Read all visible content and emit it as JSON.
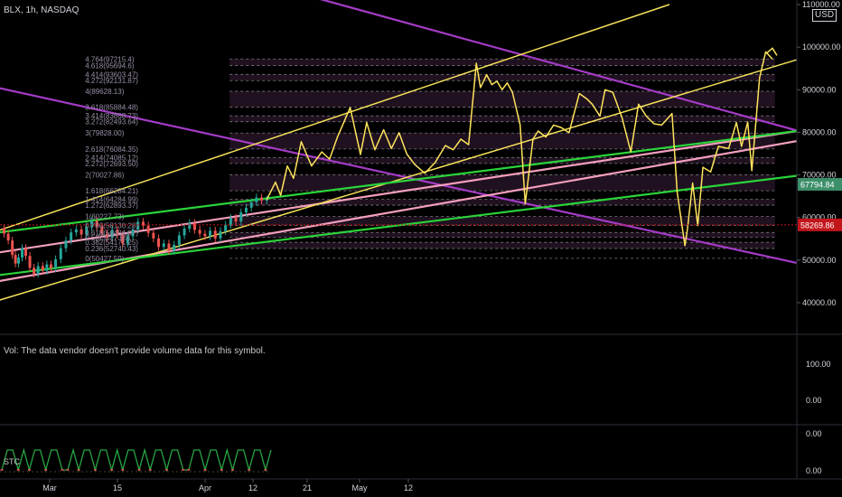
{
  "header": {
    "symbol_info": "BLX, 1h, NASDAQ"
  },
  "price_scale": {
    "currency": "USD",
    "ticks": [
      "110000.00",
      "100000.00",
      "90000.00",
      "80000.00",
      "70000.00",
      "60000.00",
      "50000.00",
      "40000.00"
    ],
    "badges": [
      {
        "text": "67794.84",
        "value": 67794.84,
        "color": "#3d8f6a"
      },
      {
        "text": "58269.86",
        "value": 58269.86,
        "color": "#c2161b"
      }
    ]
  },
  "volume_pane": {
    "message": "Vol: The data vendor doesn't provide volume data for this symbol.",
    "ticks": [
      "100.00",
      "0.00"
    ]
  },
  "stc_pane": {
    "label": "STC",
    "ticks": [
      "0.00",
      "0.00"
    ]
  },
  "time_axis": {
    "labels": [
      "Mar",
      "15",
      "Apr",
      "12",
      "21",
      "May",
      "12"
    ]
  },
  "colors": {
    "fib_level_line": "#7a7a7a",
    "fib_label": "#9a8fa6",
    "fib_zone": "#3a1f3a",
    "purple_line": "#a43bc6",
    "pink_line": "#f49fbd",
    "yellow_line": "#f5e15a",
    "green_line": "#2ad43a",
    "projection": "#ffe45c",
    "price_up": "#26a69a",
    "price_down": "#ef5350",
    "stc_line": "#26a644",
    "stc_low": "#ef5350"
  },
  "chart_data": {
    "type": "line",
    "title": "BLX, 1h, NASDAQ",
    "y_axis": {
      "min": 35000,
      "max": 110000,
      "unit": "USD"
    },
    "x_axis_labels": [
      "Mar",
      "15",
      "Apr",
      "12",
      "21",
      "May",
      "12"
    ],
    "fib_levels": [
      {
        "label": "4.764(97215.4)",
        "value": 97215.4
      },
      {
        "label": "4.618(95694.6)",
        "value": 95694.6
      },
      {
        "label": "4.414(93603.47)",
        "value": 93603.47
      },
      {
        "label": "4.272(92131.87)",
        "value": 92131.87
      },
      {
        "label": "4(89628.13)",
        "value": 89628.13
      },
      {
        "label": "3.618(85884.48)",
        "value": 85884.48
      },
      {
        "label": "3.414(83868.73)",
        "value": 83868.73
      },
      {
        "label": "3.272(82493.64)",
        "value": 82493.64
      },
      {
        "label": "3(79828.00)",
        "value": 79828.0
      },
      {
        "label": "2.618(76084.35)",
        "value": 76084.35
      },
      {
        "label": "2.414(74085.12)",
        "value": 74085.12
      },
      {
        "label": "2.272(72693.50)",
        "value": 72693.5
      },
      {
        "label": "2(70027.86)",
        "value": 70027.86
      },
      {
        "label": "1.618(66284.21)",
        "value": 66284.21
      },
      {
        "label": "1.414(64284.99)",
        "value": 64284.99
      },
      {
        "label": "1.272(62893.37)",
        "value": 62893.37
      },
      {
        "label": "1(60227.73)",
        "value": 60227.73
      },
      {
        "label": "0.786(58130.28)",
        "value": 58130.28
      },
      {
        "label": "0.618(56484.07)",
        "value": 56484.07
      },
      {
        "label": "0.5(55327.66)",
        "value": 55327.66
      },
      {
        "label": "0.382(54171.25)",
        "value": 54171.25
      },
      {
        "label": "0.236(52740.43)",
        "value": 52740.43
      },
      {
        "label": "0(50427.59)",
        "value": 50427.59
      }
    ],
    "series": [
      {
        "role": "price",
        "points": [
          [
            0.0,
            57500
          ],
          [
            0.008,
            56200
          ],
          [
            0.016,
            54600
          ],
          [
            0.024,
            51200
          ],
          [
            0.03,
            49200
          ],
          [
            0.036,
            50600
          ],
          [
            0.043,
            52800
          ],
          [
            0.05,
            51000
          ],
          [
            0.058,
            48200
          ],
          [
            0.066,
            46800
          ],
          [
            0.074,
            48600
          ],
          [
            0.083,
            47500
          ],
          [
            0.091,
            49000
          ],
          [
            0.099,
            48100
          ],
          [
            0.108,
            50200
          ],
          [
            0.118,
            52800
          ],
          [
            0.128,
            54600
          ],
          [
            0.138,
            56500
          ],
          [
            0.148,
            57200
          ],
          [
            0.158,
            56000
          ],
          [
            0.168,
            57800
          ],
          [
            0.178,
            59200
          ],
          [
            0.188,
            57900
          ],
          [
            0.198,
            56200
          ],
          [
            0.208,
            55300
          ],
          [
            0.218,
            57100
          ],
          [
            0.228,
            55900
          ],
          [
            0.238,
            53900
          ],
          [
            0.248,
            55600
          ],
          [
            0.258,
            57200
          ],
          [
            0.268,
            59000
          ],
          [
            0.278,
            58100
          ],
          [
            0.288,
            56400
          ],
          [
            0.298,
            55100
          ],
          [
            0.308,
            53100
          ],
          [
            0.318,
            53900
          ],
          [
            0.328,
            52200
          ],
          [
            0.338,
            53600
          ],
          [
            0.348,
            55800
          ],
          [
            0.358,
            57400
          ],
          [
            0.368,
            58700
          ],
          [
            0.378,
            57100
          ],
          [
            0.388,
            56200
          ],
          [
            0.398,
            55600
          ],
          [
            0.408,
            56900
          ],
          [
            0.418,
            55100
          ],
          [
            0.428,
            56800
          ],
          [
            0.438,
            58300
          ],
          [
            0.448,
            59900
          ],
          [
            0.458,
            59100
          ],
          [
            0.468,
            61200
          ],
          [
            0.478,
            62300
          ],
          [
            0.488,
            63600
          ],
          [
            0.498,
            64700
          ],
          [
            0.508,
            64000
          ],
          [
            0.518,
            64200
          ]
        ]
      },
      {
        "role": "projection",
        "points": [
          [
            0.518,
            64200
          ],
          [
            0.535,
            68300
          ],
          [
            0.545,
            65200
          ],
          [
            0.558,
            72100
          ],
          [
            0.57,
            69200
          ],
          [
            0.585,
            77800
          ],
          [
            0.605,
            72100
          ],
          [
            0.625,
            75400
          ],
          [
            0.64,
            73700
          ],
          [
            0.655,
            78800
          ],
          [
            0.68,
            85800
          ],
          [
            0.7,
            74800
          ],
          [
            0.712,
            82300
          ],
          [
            0.728,
            75900
          ],
          [
            0.745,
            80600
          ],
          [
            0.76,
            76200
          ],
          [
            0.775,
            79900
          ],
          [
            0.79,
            74900
          ],
          [
            0.805,
            72500
          ],
          [
            0.825,
            70400
          ],
          [
            0.845,
            72900
          ],
          [
            0.865,
            76900
          ],
          [
            0.88,
            75900
          ],
          [
            0.895,
            78400
          ],
          [
            0.91,
            77100
          ],
          [
            0.925,
            96200
          ],
          [
            0.933,
            90500
          ],
          [
            0.945,
            93500
          ],
          [
            0.955,
            91200
          ],
          [
            0.965,
            92000
          ],
          [
            0.975,
            90000
          ],
          [
            0.985,
            91600
          ],
          [
            0.995,
            89400
          ],
          [
            1.01,
            81800
          ],
          [
            1.02,
            63200
          ],
          [
            1.035,
            78400
          ],
          [
            1.045,
            80300
          ],
          [
            1.06,
            78900
          ],
          [
            1.075,
            81700
          ],
          [
            1.09,
            81100
          ],
          [
            1.105,
            79900
          ],
          [
            1.125,
            89100
          ],
          [
            1.14,
            87800
          ],
          [
            1.15,
            86600
          ],
          [
            1.165,
            83800
          ],
          [
            1.175,
            90000
          ],
          [
            1.19,
            89400
          ],
          [
            1.208,
            83400
          ],
          [
            1.225,
            75400
          ],
          [
            1.24,
            86600
          ],
          [
            1.255,
            83800
          ],
          [
            1.27,
            82000
          ],
          [
            1.285,
            81700
          ],
          [
            1.305,
            84400
          ],
          [
            1.315,
            66000
          ],
          [
            1.33,
            53400
          ],
          [
            1.335,
            57300
          ],
          [
            1.345,
            68100
          ],
          [
            1.355,
            58100
          ],
          [
            1.365,
            71800
          ],
          [
            1.38,
            70700
          ],
          [
            1.395,
            76700
          ],
          [
            1.415,
            76200
          ],
          [
            1.43,
            82300
          ],
          [
            1.44,
            76700
          ],
          [
            1.452,
            82400
          ],
          [
            1.46,
            71000
          ],
          [
            1.475,
            92800
          ],
          [
            1.487,
            98900
          ],
          [
            1.5,
            97200
          ]
        ]
      }
    ],
    "stc": {
      "range": [
        0,
        100
      ],
      "pattern": [
        0,
        100,
        100,
        0,
        100,
        0,
        100,
        100,
        0,
        100,
        100,
        0,
        0,
        100,
        0,
        100,
        100,
        0,
        100,
        100,
        0,
        100,
        0,
        100,
        100,
        0,
        100,
        0,
        100,
        100,
        0,
        100,
        100,
        0,
        0,
        100,
        100,
        0,
        100,
        100,
        0,
        100,
        0,
        100,
        100,
        0,
        100,
        100,
        0,
        100
      ]
    }
  }
}
